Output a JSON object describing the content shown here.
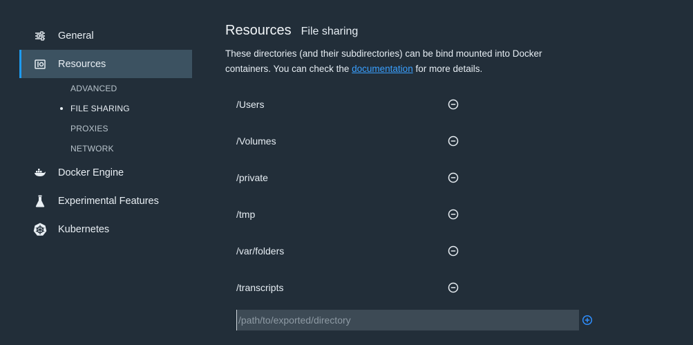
{
  "sidebar": {
    "items": [
      {
        "label": "General",
        "icon": "sliders-icon"
      },
      {
        "label": "Resources",
        "icon": "resources-icon",
        "active": true
      },
      {
        "label": "Docker Engine",
        "icon": "docker-whale-icon"
      },
      {
        "label": "Experimental Features",
        "icon": "flask-icon"
      },
      {
        "label": "Kubernetes",
        "icon": "kubernetes-helm-icon"
      }
    ],
    "subitems": [
      {
        "label": "ADVANCED"
      },
      {
        "label": "FILE SHARING",
        "current": true
      },
      {
        "label": "PROXIES"
      },
      {
        "label": "NETWORK"
      }
    ]
  },
  "main": {
    "title": "Resources",
    "subtitle": "File sharing",
    "description": {
      "before": "These directories (and their subdirectories) can be bind mounted into Docker containers. You can check the ",
      "link": "documentation",
      "after": " for more details."
    },
    "directories": [
      "/Users",
      "/Volumes",
      "/private",
      "/tmp",
      "/var/folders",
      "/transcripts"
    ],
    "input": {
      "placeholder": "/path/to/exported/directory",
      "value": ""
    }
  },
  "colors": {
    "background": "#222e39",
    "active_item": "#3c5261",
    "accent": "#1d9bf0",
    "link": "#3aa0ff",
    "input_bg": "#3d4a55"
  }
}
